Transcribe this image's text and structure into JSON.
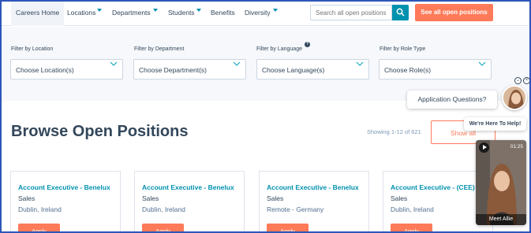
{
  "nav": {
    "items": [
      {
        "label": "Careers Home",
        "caret": false
      },
      {
        "label": "Locations",
        "caret": true
      },
      {
        "label": "Departments",
        "caret": true
      },
      {
        "label": "Students",
        "caret": true
      },
      {
        "label": "Benefits",
        "caret": false
      },
      {
        "label": "Diversity",
        "caret": true
      }
    ],
    "search_placeholder": "Search all open positions",
    "see_all_label": "See all open positions"
  },
  "filters": [
    {
      "label": "Filter by Location",
      "value": "Choose Location(s)"
    },
    {
      "label": "Filter by Department",
      "value": "Choose Department(s)"
    },
    {
      "label": "Filter by Language",
      "value": "Choose Language(s)"
    },
    {
      "label": "Filter by Role Type",
      "value": "Choose Role(s)"
    }
  ],
  "main": {
    "title": "Browse Open Positions",
    "showing": "Showing 1-12 of 621",
    "show_all_label": "Show all"
  },
  "jobs": [
    {
      "title": "Account Executive - Benelux",
      "department": "Sales",
      "location": "Dublin, Ireland",
      "apply_label": "Apply"
    },
    {
      "title": "Account Executive - Benelux",
      "department": "Sales",
      "location": "Dublin, Ireland",
      "apply_label": "Apply"
    },
    {
      "title": "Account Executive - Benelux",
      "department": "Sales",
      "location": "Remote - Germany",
      "apply_label": "Apply"
    },
    {
      "title": "Account Executive - (CEE)",
      "department": "Sales",
      "location": "Dublin, Ireland",
      "apply_label": "Apply"
    }
  ],
  "chat": {
    "question": "Application Questions?",
    "help": "We're Here To Help!",
    "video_duration": "01:25",
    "video_name": "Meet Allie"
  },
  "colors": {
    "accent": "#ff7a59",
    "link": "#0091ae",
    "text": "#33475b"
  }
}
